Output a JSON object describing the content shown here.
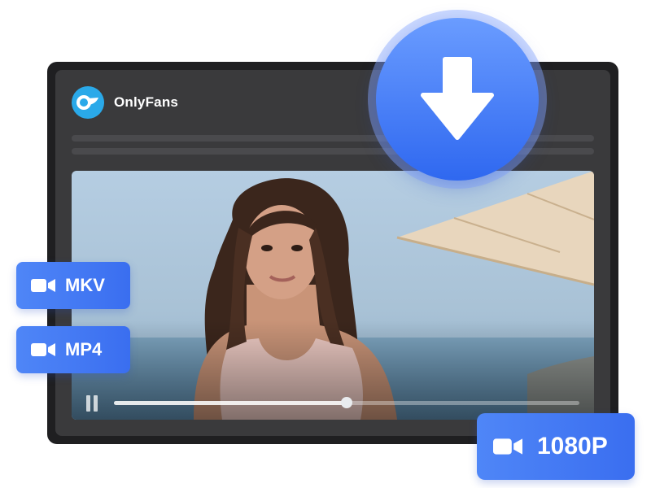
{
  "brand": {
    "name": "OnlyFans",
    "logo_icon": "onlyfans-logo-icon",
    "logo_color": "#2aa9e9"
  },
  "video": {
    "playback_state": "paused",
    "progress_percent": 50
  },
  "download": {
    "icon": "download-arrow-icon",
    "accent": "#3b74f2"
  },
  "formats": [
    {
      "label": "MKV",
      "icon": "video-camera-icon"
    },
    {
      "label": "MP4",
      "icon": "video-camera-icon"
    }
  ],
  "resolution": {
    "label": "1080P",
    "icon": "video-camera-icon"
  }
}
